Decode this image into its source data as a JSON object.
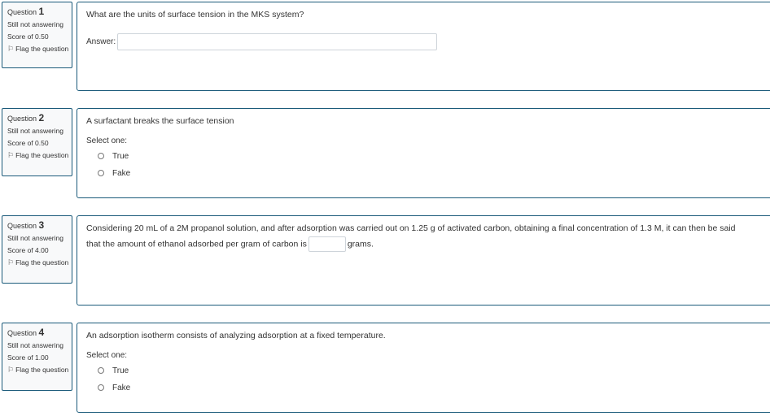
{
  "questions": [
    {
      "label": "Question",
      "number": "1",
      "state": "Still not answering",
      "grade": "Score of 0.50",
      "flag": "Flag the question",
      "text": "What are the units of surface tension in the MKS system?",
      "answer_label": "Answer:",
      "answer_value": ""
    },
    {
      "label": "Question",
      "number": "2",
      "state": "Still not answering",
      "grade": "Score of 0.50",
      "flag": "Flag the question",
      "text": "A surfactant breaks the surface tension",
      "prompt": "Select one:",
      "options": [
        "True",
        "Fake"
      ]
    },
    {
      "label": "Question",
      "number": "3",
      "state": "Still not answering",
      "grade": "Score of 4.00",
      "flag": "Flag the question",
      "text_before": "Considering 20 mL of a 2M propanol solution, and after adsorption was carried out on 1.25 g of activated carbon, obtaining a final concentration of 1.3 M, it can then be said that the amount of ethanol adsorbed per gram of carbon is",
      "text_after": "grams.",
      "answer_value": ""
    },
    {
      "label": "Question",
      "number": "4",
      "state": "Still not answering",
      "grade": "Score of 1.00",
      "flag": "Flag the question",
      "text": "An adsorption isotherm consists of analyzing adsorption at a fixed temperature.",
      "prompt": "Select one:",
      "options": [
        "True",
        "Fake"
      ]
    }
  ]
}
